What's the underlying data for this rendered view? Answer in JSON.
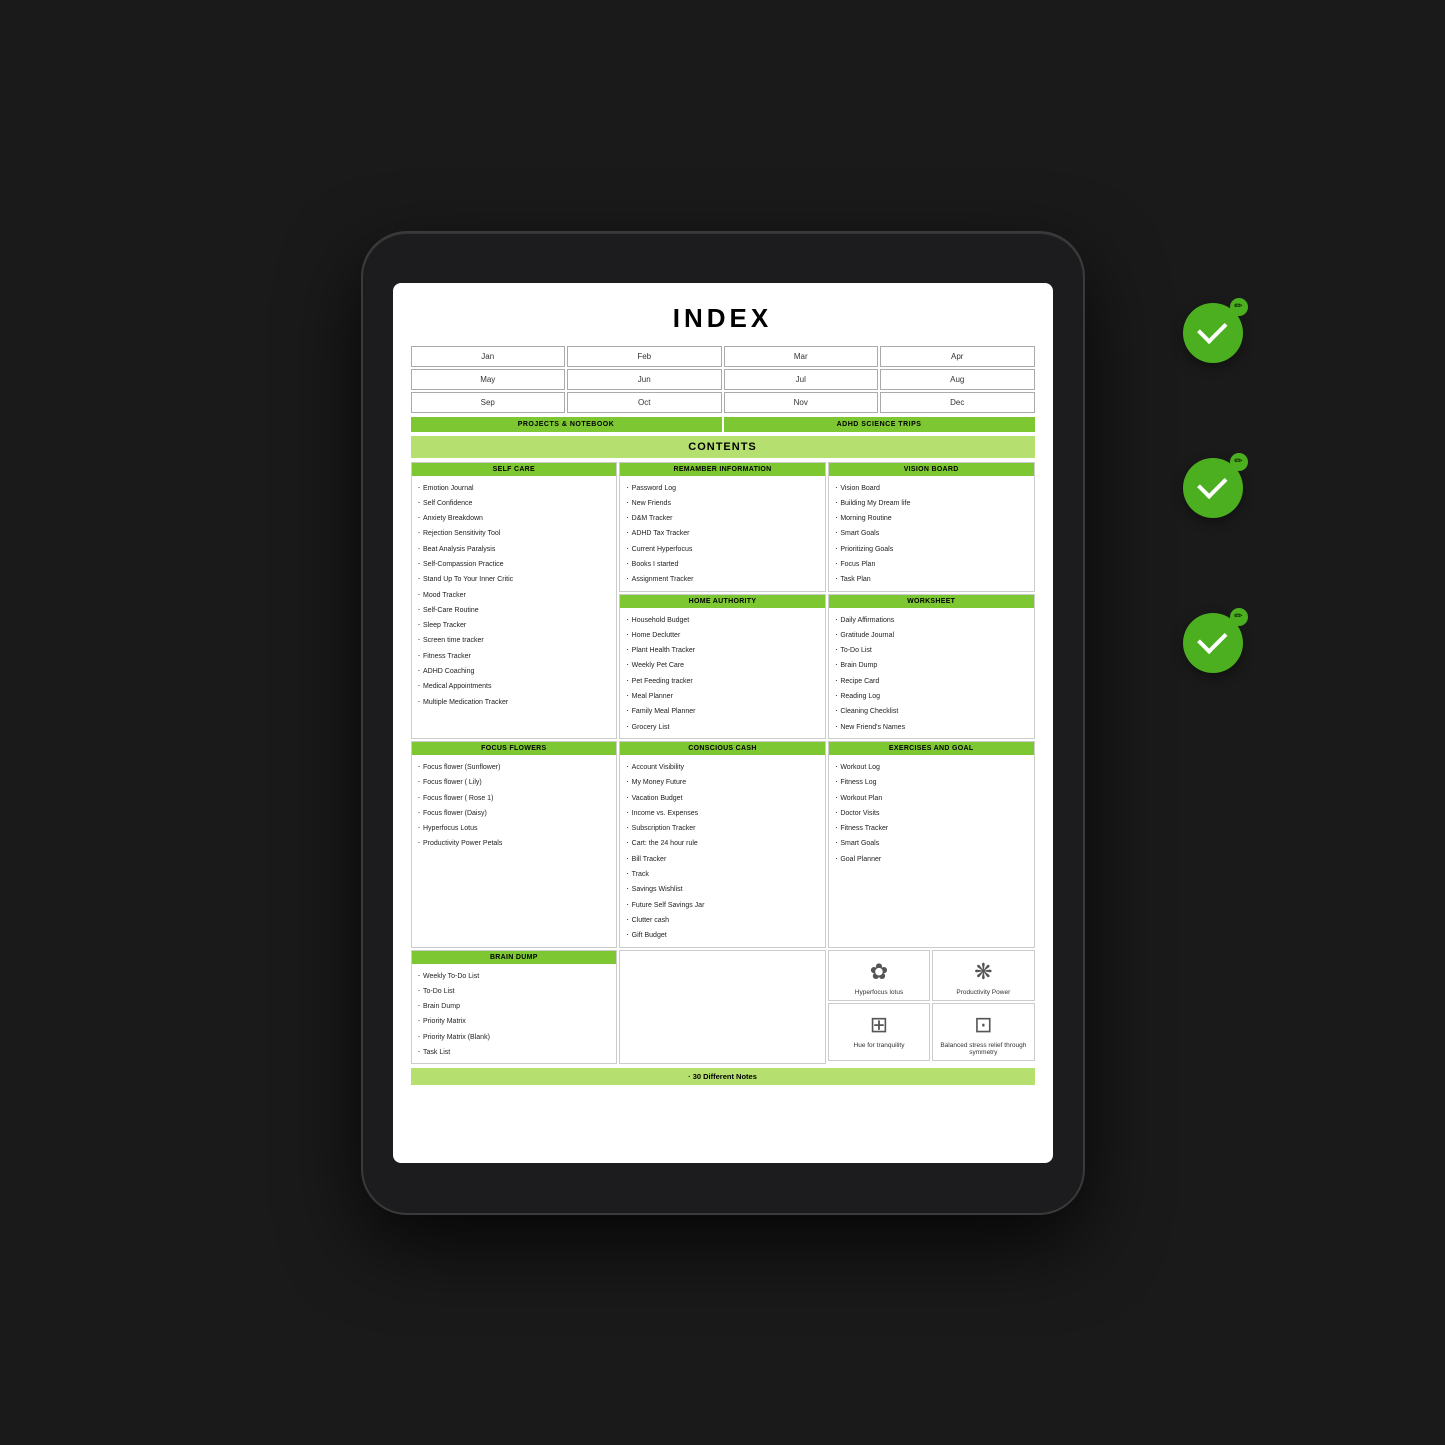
{
  "title": "INDEX",
  "months": [
    "Jan",
    "Feb",
    "Mar",
    "Apr",
    "May",
    "Jun",
    "Jul",
    "Aug",
    "Sep",
    "Oct",
    "Nov",
    "Dec"
  ],
  "topHeaders": {
    "left": "PROJECTS & NOTEBOOK",
    "right": "ADHD SCIENCE TRIPS"
  },
  "contentsLabel": "CONTENTS",
  "sections": {
    "rememberInfo": {
      "header": "REMAMBER INFORMATION",
      "items": [
        "Password Log",
        "New Friends",
        "D&M Tracker",
        "ADHD Tax Tracker",
        "Current Hyperfocus",
        "Books I started",
        "Assignment Tracker"
      ]
    },
    "visionBoard": {
      "header": "VISION BOARD",
      "items": [
        "Vision Board",
        "Building My Dream life",
        "Morning Routine",
        "Smart Goals",
        "Prioritizing Goals",
        "Focus Plan",
        "Task Plan"
      ]
    },
    "selfCare": {
      "header": "SELF CARE",
      "items": [
        "Emotion Journal",
        "Self Confidence",
        "Anxiety Breakdown",
        "Rejection Sensitivity Tool",
        "Beat Analysis Paralysis",
        "Self-Compassion Practice",
        "Stand Up To Your Inner Critic",
        "Mood Tracker",
        "Self-Care Routine",
        "Sleep Tracker",
        "Screen time tracker",
        "Fitness Tracker",
        "ADHD Coaching",
        "Medical Appointments",
        "Multiple Medication Tracker"
      ]
    },
    "homeAuthority": {
      "header": "HOME AUTHORITY",
      "items": [
        "Household Budget",
        "Home Declutter",
        "Plant Health Tracker",
        "Weekly Pet Care",
        "Pet Feeding tracker",
        "Meal Planner",
        "Family Meal Planner",
        "Grocery List"
      ]
    },
    "worksheet": {
      "header": "WORKSHEET",
      "items": [
        "Daily Affirmations",
        "Gratitude Journal",
        "To-Do List",
        "Brain Dump",
        "Recipe Card",
        "Reading Log",
        "Cleaning Checklist",
        "New Friend's Names"
      ]
    },
    "exercisesGoal": {
      "header": "EXERCISES AND GOAL",
      "items": [
        "Workout Log",
        "Fitness Log",
        "Workout Plan",
        "Doctor Visits",
        "Fitness Tracker",
        "Smart Goals",
        "Goal Planner"
      ]
    },
    "focusFlowers": {
      "header": "FOCUS FLOWERS",
      "items": [
        "Focus flower (Sunflower)",
        "Focus flower ( Lily)",
        "Focus flower ( Rose 1)",
        "Focus flower (Daisy)",
        "Hyperfocus Lotus",
        "Productivity Power Petals"
      ]
    },
    "consciousCash": {
      "header": "CONSCIOUS CASH",
      "items": [
        "Account Visibility",
        "My Money Future",
        "Vacation Budget",
        "Income vs. Expenses",
        "Subscription Tracker",
        "Cart: the 24 hour rule",
        "Bill Tracker",
        "Track",
        "Savings Wishlist",
        "Future  Self  Savings Jar",
        "Clutter cash",
        "Gift Budget"
      ]
    },
    "brainDump": {
      "header": "BRAIN DUMP",
      "items": [
        "Weekly To-Do List",
        "To-Do List",
        "Brain Dump",
        "Priority Matrix",
        "Priority Matrix (Blank)",
        "Task List"
      ]
    }
  },
  "icons": [
    {
      "label": "Hyperfocus lotus",
      "symbol": "✿"
    },
    {
      "label": "Productivity Power",
      "symbol": "❋"
    },
    {
      "label": "Hue for tranquility",
      "symbol": "⊞"
    },
    {
      "label": "Balanced stress relief through symmetry",
      "symbol": "⊡"
    }
  ],
  "footer": "· 30 Different Notes",
  "checkBadges": [
    {
      "id": "badge-1"
    },
    {
      "id": "badge-2"
    },
    {
      "id": "badge-3"
    }
  ]
}
